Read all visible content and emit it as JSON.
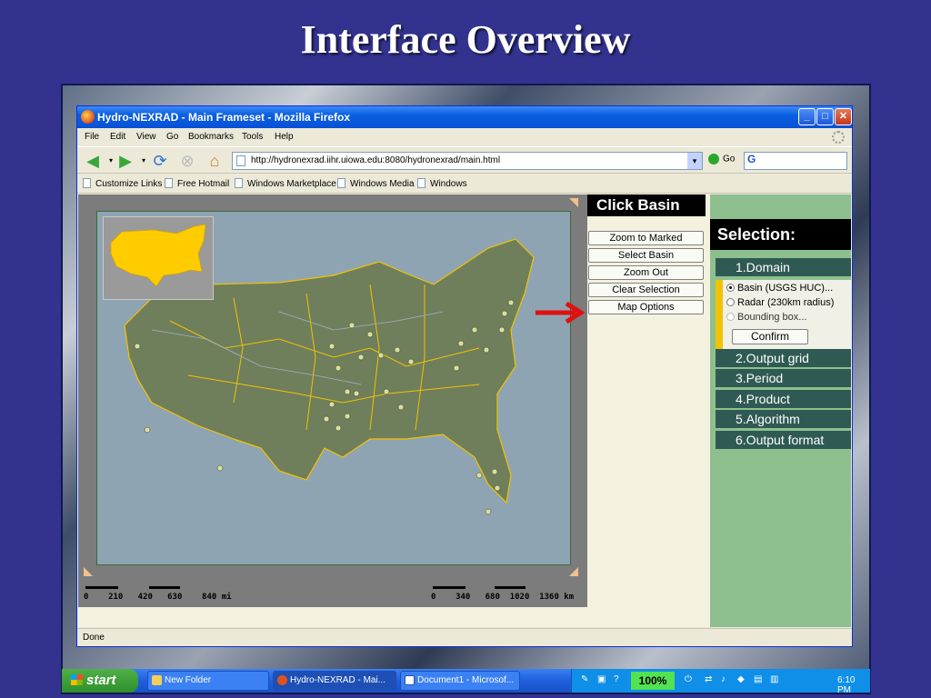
{
  "slide": {
    "title": "Interface Overview"
  },
  "browser": {
    "window_title": "Hydro-NEXRAD - Main Frameset - Mozilla Firefox",
    "menu": [
      "File",
      "Edit",
      "View",
      "Go",
      "Bookmarks",
      "Tools",
      "Help"
    ],
    "url": "http://hydronexrad.iihr.uiowa.edu:8080/hydronexrad/main.html",
    "go_label": "Go",
    "search_value": "G",
    "bookmarks": [
      "Customize Links",
      "Free Hotmail",
      "Windows Marketplace",
      "Windows Media",
      "Windows"
    ],
    "status": "Done"
  },
  "app": {
    "click_basin_label": "Click Basin",
    "buttons": [
      "Zoom to Marked",
      "Select Basin",
      "Zoom Out",
      "Clear Selection",
      "Map Options"
    ],
    "selection_header": "Selection:",
    "steps": [
      "1.Domain",
      "2.Output grid",
      "3.Period",
      "4.Product",
      "5.Algorithm",
      "6.Output format"
    ],
    "domain_options": [
      {
        "label": "Basin (USGS HUC)...",
        "checked": true
      },
      {
        "label": "Radar (230km radius)",
        "checked": false
      },
      {
        "label": "Bounding box...",
        "checked": false,
        "disabled": true
      }
    ],
    "confirm_label": "Confirm",
    "scale_left": "0    210   420   630    840 mi",
    "scale_right": "0    340   680  1020  1360 km"
  },
  "taskbar": {
    "start_label": "start",
    "items": [
      "New Folder",
      "Hydro-NEXRAD - Mai...",
      "Document1 - Microsof..."
    ],
    "zoom": "100%",
    "clock": "6:10 PM"
  },
  "colors": {
    "slide_bg": "#33338f",
    "map_land": "#6f7f5c",
    "map_water": "#8ea4b2",
    "basin_outline": "#f2c200",
    "selection_panel": "#8ec08f",
    "step_bg": "#2f5a53",
    "arrow": "#e01010"
  }
}
